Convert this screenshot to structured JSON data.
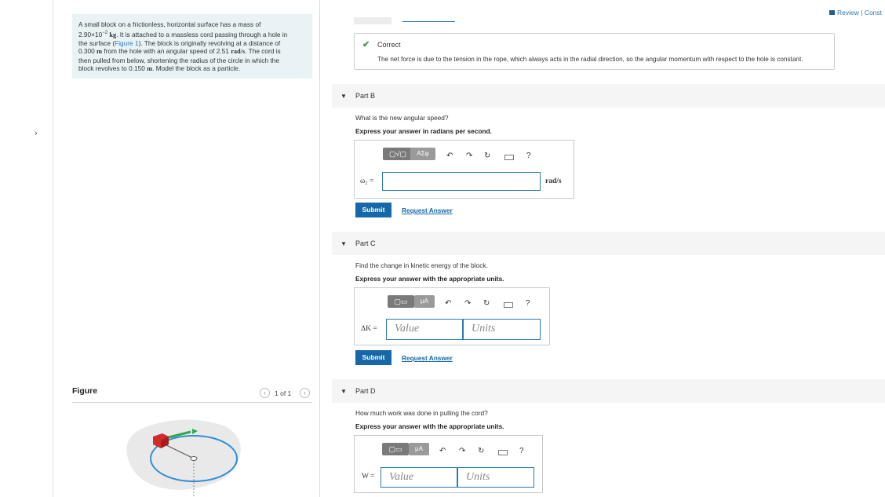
{
  "left_panel": {
    "expand_glyph": "›",
    "problem": {
      "line1": "A small block on a frictionless, horizontal surface has a mass of",
      "line2_mass": "2.90×10",
      "line2_exp": "−2",
      "line2_unit": "kg",
      "line2_rest": ". It is attached to a massless cord passing through a hole in",
      "line3_pre": "the surface (",
      "line3_link": "Figure 1",
      "line3_post": "). The block is originally revolving at a distance of",
      "line4_dist": "0.300",
      "line4_unit": "m",
      "line4_mid": "from the hole with an angular speed of 2.51",
      "line4_unit2": "rad/s",
      "line4_post": ". The cord is",
      "line5": "then pulled from below, shortening the radius of the circle in which the",
      "line6_pre": "block revolves to 0.150",
      "line6_unit": "m",
      "line6_post": ". Model the block as a particle."
    },
    "figure": {
      "label": "Figure",
      "counter": "1 of 1",
      "prev_glyph": "‹",
      "next_glyph": "›"
    }
  },
  "header": {
    "review_link": "Review | Const"
  },
  "correct_feedback": {
    "title": "Correct",
    "text": "The net force is due to the tension in the rope, which always acts in the radial direction, so the angular momentum with respect to the hole is constant."
  },
  "parts": [
    {
      "title": "Part B",
      "question": "What is the new angular speed?",
      "instruction": "Express your answer in radians per second.",
      "variable": "ω₂ =",
      "unit": "rad/s",
      "toolbar_labels": [
        "▢√▢",
        "ΑΣφ"
      ],
      "submit_label": "Submit",
      "request_label": "Request Answer"
    },
    {
      "title": "Part C",
      "question": "Find the change in kinetic energy of the block.",
      "instruction": "Express your answer with the appropriate units.",
      "variable": "ΔK =",
      "value_placeholder": "Value",
      "units_placeholder": "Units",
      "toolbar_labels": [
        "▢▭",
        "μA"
      ],
      "submit_label": "Submit",
      "request_label": "Request Answer"
    },
    {
      "title": "Part D",
      "question": "How much work was done in pulling the cord?",
      "instruction": "Express your answer with the appropriate units.",
      "variable": "W =",
      "value_placeholder": "Value",
      "units_placeholder": "Units",
      "toolbar_labels": [
        "▢▭",
        "μA"
      ]
    }
  ],
  "toolbar_common": {
    "undo": "↶",
    "redo": "↷",
    "reset": "↻",
    "help": "?"
  },
  "colors": {
    "accent": "#1768a9",
    "correct": "#3a9a3a",
    "problem_bg": "#e9f3f6"
  }
}
